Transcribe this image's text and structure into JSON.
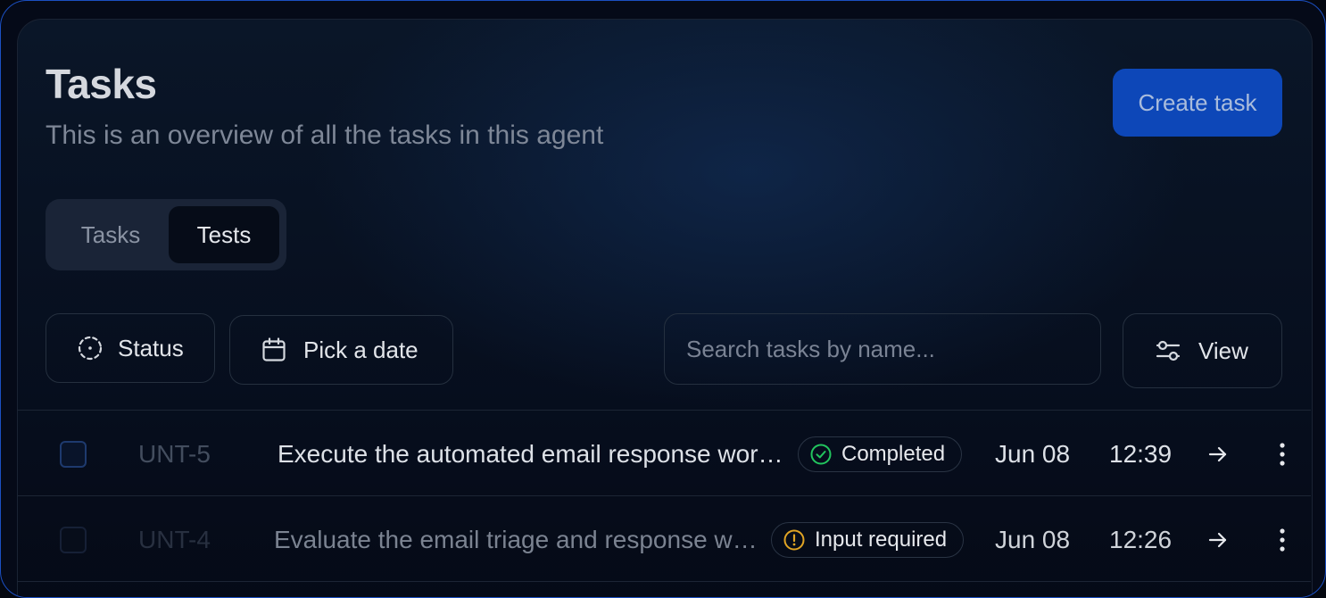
{
  "header": {
    "title": "Tasks",
    "subtitle": "This is an overview of all the tasks in this agent",
    "create_button": "Create task"
  },
  "segmented": {
    "tabs": [
      {
        "label": "Tasks",
        "active": false
      },
      {
        "label": "Tests",
        "active": true
      }
    ]
  },
  "filters": {
    "status_label": "Status",
    "date_label": "Pick a date",
    "search_placeholder": "Search tasks by name...",
    "view_label": "View"
  },
  "icons": {
    "status": "dashed-circle-icon",
    "date": "calendar-icon",
    "view": "sliders-icon",
    "completed": "check-circle-icon",
    "input_required": "alert-circle-icon",
    "open": "arrow-right-icon",
    "more": "vertical-dots-icon"
  },
  "colors": {
    "primary_button": "#0d47b8",
    "completed_green": "#22c55e",
    "warning_amber": "#e0a424",
    "frame_border": "#1b4fc2"
  },
  "rows": [
    {
      "id": "UNT-5",
      "name": "Execute the automated email response workfl...",
      "status": "Completed",
      "date": "Jun 08",
      "time": "12:39"
    },
    {
      "id": "UNT-4",
      "name": "Evaluate the email triage and response wor...",
      "status": "Input required",
      "date": "Jun 08",
      "time": "12:26"
    }
  ]
}
